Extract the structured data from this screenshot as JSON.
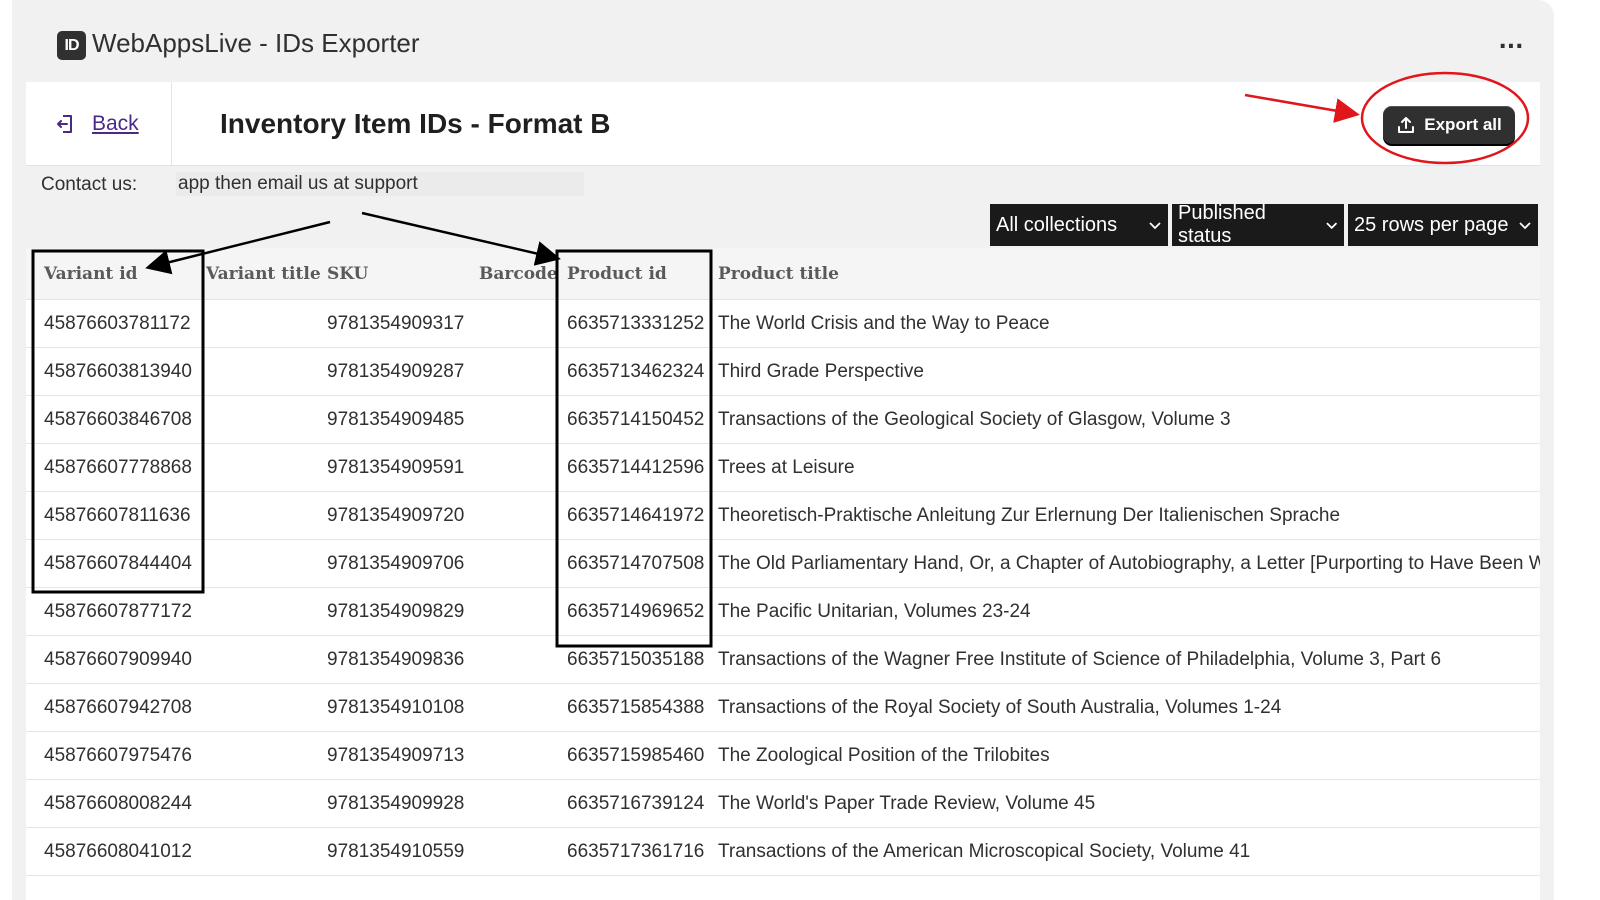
{
  "app": {
    "logo_text": "ID",
    "title": "WebAppsLive - IDs Exporter",
    "more_label": "..."
  },
  "header": {
    "back_label": "Back",
    "page_title": "Inventory Item IDs - Format B",
    "export_label": "Export all"
  },
  "contact": {
    "label": "Contact us:",
    "text": "app then email us at support"
  },
  "filters": {
    "collection": "All collections",
    "status": "Published status",
    "rows": "25 rows per page"
  },
  "table": {
    "headers": {
      "variant_id": "Variant id",
      "variant_title": "Variant title",
      "sku": "SKU",
      "barcode": "Barcode",
      "product_id": "Product id",
      "product_title": "Product title"
    },
    "rows": [
      {
        "variant_id": "45876603781172",
        "variant_title": "",
        "sku": "9781354909317",
        "barcode": "",
        "product_id": "6635713331252",
        "product_title": "The World Crisis and the Way to Peace"
      },
      {
        "variant_id": "45876603813940",
        "variant_title": "",
        "sku": "9781354909287",
        "barcode": "",
        "product_id": "6635713462324",
        "product_title": "Third Grade Perspective"
      },
      {
        "variant_id": "45876603846708",
        "variant_title": "",
        "sku": "9781354909485",
        "barcode": "",
        "product_id": "6635714150452",
        "product_title": "Transactions of the Geological Society of Glasgow, Volume 3"
      },
      {
        "variant_id": "45876607778868",
        "variant_title": "",
        "sku": "9781354909591",
        "barcode": "",
        "product_id": "6635714412596",
        "product_title": "Trees at Leisure"
      },
      {
        "variant_id": "45876607811636",
        "variant_title": "",
        "sku": "9781354909720",
        "barcode": "",
        "product_id": "6635714641972",
        "product_title": "Theoretisch-Praktische Anleitung Zur Erlernung Der Italienischen Sprache"
      },
      {
        "variant_id": "45876607844404",
        "variant_title": "",
        "sku": "9781354909706",
        "barcode": "",
        "product_id": "6635714707508",
        "product_title": "The Old Parliamentary Hand, Or, a Chapter of Autobiography, a Letter [Purporting to Have Been W"
      },
      {
        "variant_id": "45876607877172",
        "variant_title": "",
        "sku": "9781354909829",
        "barcode": "",
        "product_id": "6635714969652",
        "product_title": "The Pacific Unitarian, Volumes 23-24"
      },
      {
        "variant_id": "45876607909940",
        "variant_title": "",
        "sku": "9781354909836",
        "barcode": "",
        "product_id": "6635715035188",
        "product_title": "Transactions of the Wagner Free Institute of Science of Philadelphia, Volume 3, Part 6"
      },
      {
        "variant_id": "45876607942708",
        "variant_title": "",
        "sku": "9781354910108",
        "barcode": "",
        "product_id": "6635715854388",
        "product_title": "Transactions of the Royal Society of South Australia, Volumes 1-24"
      },
      {
        "variant_id": "45876607975476",
        "variant_title": "",
        "sku": "9781354909713",
        "barcode": "",
        "product_id": "6635715985460",
        "product_title": "The Zoological Position of the Trilobites"
      },
      {
        "variant_id": "45876608008244",
        "variant_title": "",
        "sku": "9781354909928",
        "barcode": "",
        "product_id": "6635716739124",
        "product_title": "The World's Paper Trade Review, Volume 45"
      },
      {
        "variant_id": "45876608041012",
        "variant_title": "",
        "sku": "9781354910559",
        "barcode": "",
        "product_id": "6635717361716",
        "product_title": "Transactions of the American Microscopical Society, Volume 41"
      },
      {
        "variant_id": "",
        "variant_title": "",
        "sku": "",
        "barcode": "",
        "product_id": "",
        "product_title": ""
      }
    ]
  },
  "annotation_colors": {
    "red": "#e0161b",
    "black": "#000000"
  }
}
